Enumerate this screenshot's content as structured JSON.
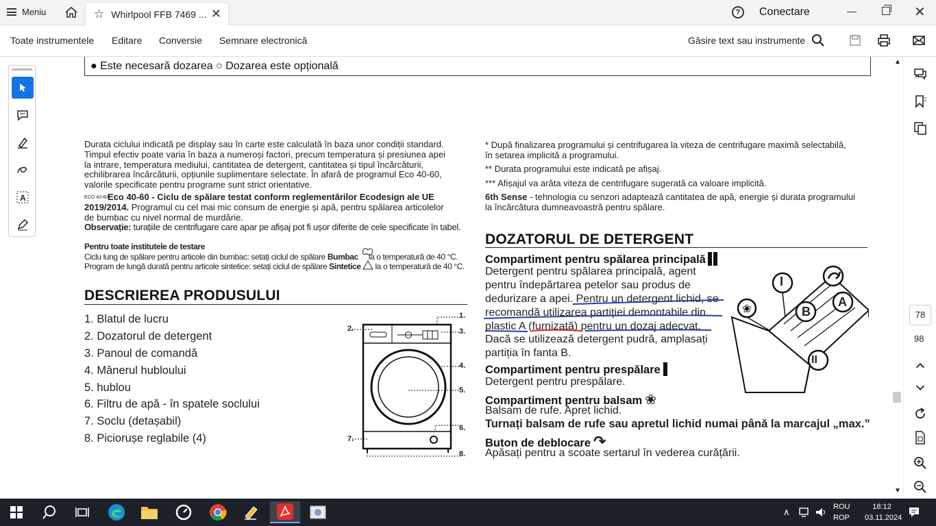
{
  "topbar": {
    "menu_label": "Meniu",
    "tab_title": "Whirlpool FFB 7469 ...",
    "connect_label": "Conectare"
  },
  "toolbar": {
    "items": [
      "Toate instrumentele",
      "Editare",
      "Conversie",
      "Semnare electronică"
    ],
    "find_label": "Găsire text sau instrumente"
  },
  "document": {
    "legend": "● Este necesară dozarea  ○ Dozarea este opțională",
    "left_paragraph": [
      "Durata ciclului indicată pe display sau în carte este calculată în baza unor condiții standard.",
      "Timpul efectiv poate varia în baza a numeroși factori, precum temperatura și presiunea apei",
      "la intrare, temperatura mediului, cantitatea de detergent, cantitatea și tipul încărcăturii,",
      "echilibrarea încărcăturii, opțiunile suplimentare selectate. În afară de programul Eco 40-60,",
      "valorile specificate pentru programe sunt strict orientative."
    ],
    "eco_icon_text": "ECO 40-60",
    "eco_title": "Eco 40-60 - Ciclu de spălare testat conform reglementărilor Ecodesign ale UE",
    "eco_line2_bold": "2019/2014.",
    "eco_line2": " Programul cu cel mai mic consum de energie și apă, pentru spălarea articolelor",
    "eco_line3": "de bumbac cu nivel normal de murdărie.",
    "obs_bold": "Observație:",
    "obs_text": " turațiile de centrifugare care apar pe afișaj pot fi ușor diferite de cele specificate în tabel.",
    "institutes_title": "Pentru toate institutele de testare",
    "inst_line1_a": "Ciclu lung de spălare pentru articole din bumbac: setați ciclul de spălare ",
    "inst_line1_b": "Bumbac",
    "inst_line1_c": " la o temperatură de 40 °C.",
    "inst_line2_a": "Program de lungă durată pentru articole sintetice: setați ciclul de spălare ",
    "inst_line2_b": "Sintetice",
    "inst_line2_c": " la o temperatură de 40 °C.",
    "desc_title": "DESCRIEREA PRODUSULUI",
    "desc_items": [
      "1.  Blatul de lucru",
      "2.  Dozatorul de detergent",
      "3.  Panoul de comandă",
      "4.  Mânerul hubloului",
      "5.  hublou",
      "6.  Filtru de apă - în spatele soclului",
      "7.  Soclu (detașabil)",
      "8.  Piciorușe reglabile (4)"
    ],
    "diagram_labels": [
      "1.",
      "2.",
      "3.",
      "4.",
      "5.",
      "6.",
      "7.",
      "8."
    ],
    "notes": [
      "*   După finalizarea programului și centrifugarea la viteza de centrifugare maximă selectabilă,",
      "     în setarea implicită a programului.",
      "** Durata programului este indicată pe afișaj.",
      "*** Afișajul va arăta viteza de centrifugare sugerată ca valoare implicită."
    ],
    "sense_bold": "6th Sense",
    "sense_text": " - tehnologia cu senzori adaptează cantitatea de apă, energie și durata programului",
    "sense_text2": "la încărcătura dumneavoastră pentru spălare.",
    "dozator_title": "DOZATORUL DE DETERGENT",
    "comp_main_title": "Compartiment pentru spălarea principală",
    "comp_main_lines": [
      "Detergent pentru spălarea principală, agent",
      "pentru îndepărtarea petelor sau produs de",
      "dedurizare a apei. Pentru un detergent lichid, se",
      "recomandă utilizarea partiției demontabile din",
      "plastic A (furnizată) pentru un dozaj adecvat.",
      "Dacă se utilizează detergent pudră, amplasați",
      "partiția în fanta B."
    ],
    "comp_pre_title": "Compartiment pentru prespălare",
    "comp_pre_text": "Detergent pentru prespălare.",
    "comp_balsam_title": "Compartiment pentru balsam",
    "comp_balsam_text": "Balsam de rufe. Apret lichid.",
    "pour_note": "Turnați balsam de rufe sau apretul lichid numai până la marcajul „max.”",
    "unlock_title": "Buton de deblocare",
    "unlock_text": "Apăsați pentru a scoate sertarul în vederea curățării.",
    "drawer_labels": [
      "I",
      "B",
      "A",
      "II"
    ]
  },
  "pager": {
    "current": "78",
    "total": "98"
  },
  "taskbar": {
    "lang_line1": "ROU",
    "lang_line2": "ROP",
    "time": "18:12",
    "date": "03.11.2024"
  }
}
